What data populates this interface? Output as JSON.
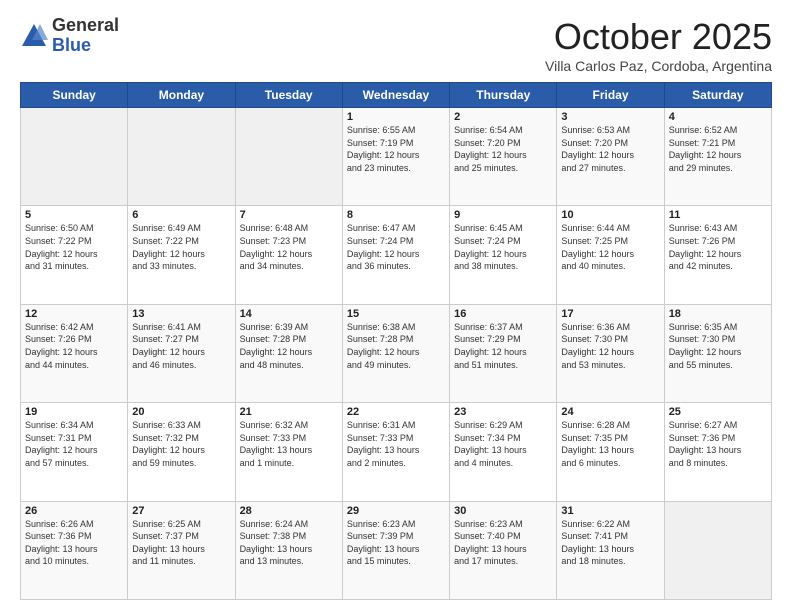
{
  "logo": {
    "general": "General",
    "blue": "Blue"
  },
  "title": "October 2025",
  "location": "Villa Carlos Paz, Cordoba, Argentina",
  "days_of_week": [
    "Sunday",
    "Monday",
    "Tuesday",
    "Wednesday",
    "Thursday",
    "Friday",
    "Saturday"
  ],
  "weeks": [
    [
      {
        "day": "",
        "info": ""
      },
      {
        "day": "",
        "info": ""
      },
      {
        "day": "",
        "info": ""
      },
      {
        "day": "1",
        "info": "Sunrise: 6:55 AM\nSunset: 7:19 PM\nDaylight: 12 hours\nand 23 minutes."
      },
      {
        "day": "2",
        "info": "Sunrise: 6:54 AM\nSunset: 7:20 PM\nDaylight: 12 hours\nand 25 minutes."
      },
      {
        "day": "3",
        "info": "Sunrise: 6:53 AM\nSunset: 7:20 PM\nDaylight: 12 hours\nand 27 minutes."
      },
      {
        "day": "4",
        "info": "Sunrise: 6:52 AM\nSunset: 7:21 PM\nDaylight: 12 hours\nand 29 minutes."
      }
    ],
    [
      {
        "day": "5",
        "info": "Sunrise: 6:50 AM\nSunset: 7:22 PM\nDaylight: 12 hours\nand 31 minutes."
      },
      {
        "day": "6",
        "info": "Sunrise: 6:49 AM\nSunset: 7:22 PM\nDaylight: 12 hours\nand 33 minutes."
      },
      {
        "day": "7",
        "info": "Sunrise: 6:48 AM\nSunset: 7:23 PM\nDaylight: 12 hours\nand 34 minutes."
      },
      {
        "day": "8",
        "info": "Sunrise: 6:47 AM\nSunset: 7:24 PM\nDaylight: 12 hours\nand 36 minutes."
      },
      {
        "day": "9",
        "info": "Sunrise: 6:45 AM\nSunset: 7:24 PM\nDaylight: 12 hours\nand 38 minutes."
      },
      {
        "day": "10",
        "info": "Sunrise: 6:44 AM\nSunset: 7:25 PM\nDaylight: 12 hours\nand 40 minutes."
      },
      {
        "day": "11",
        "info": "Sunrise: 6:43 AM\nSunset: 7:26 PM\nDaylight: 12 hours\nand 42 minutes."
      }
    ],
    [
      {
        "day": "12",
        "info": "Sunrise: 6:42 AM\nSunset: 7:26 PM\nDaylight: 12 hours\nand 44 minutes."
      },
      {
        "day": "13",
        "info": "Sunrise: 6:41 AM\nSunset: 7:27 PM\nDaylight: 12 hours\nand 46 minutes."
      },
      {
        "day": "14",
        "info": "Sunrise: 6:39 AM\nSunset: 7:28 PM\nDaylight: 12 hours\nand 48 minutes."
      },
      {
        "day": "15",
        "info": "Sunrise: 6:38 AM\nSunset: 7:28 PM\nDaylight: 12 hours\nand 49 minutes."
      },
      {
        "day": "16",
        "info": "Sunrise: 6:37 AM\nSunset: 7:29 PM\nDaylight: 12 hours\nand 51 minutes."
      },
      {
        "day": "17",
        "info": "Sunrise: 6:36 AM\nSunset: 7:30 PM\nDaylight: 12 hours\nand 53 minutes."
      },
      {
        "day": "18",
        "info": "Sunrise: 6:35 AM\nSunset: 7:30 PM\nDaylight: 12 hours\nand 55 minutes."
      }
    ],
    [
      {
        "day": "19",
        "info": "Sunrise: 6:34 AM\nSunset: 7:31 PM\nDaylight: 12 hours\nand 57 minutes."
      },
      {
        "day": "20",
        "info": "Sunrise: 6:33 AM\nSunset: 7:32 PM\nDaylight: 12 hours\nand 59 minutes."
      },
      {
        "day": "21",
        "info": "Sunrise: 6:32 AM\nSunset: 7:33 PM\nDaylight: 13 hours\nand 1 minute."
      },
      {
        "day": "22",
        "info": "Sunrise: 6:31 AM\nSunset: 7:33 PM\nDaylight: 13 hours\nand 2 minutes."
      },
      {
        "day": "23",
        "info": "Sunrise: 6:29 AM\nSunset: 7:34 PM\nDaylight: 13 hours\nand 4 minutes."
      },
      {
        "day": "24",
        "info": "Sunrise: 6:28 AM\nSunset: 7:35 PM\nDaylight: 13 hours\nand 6 minutes."
      },
      {
        "day": "25",
        "info": "Sunrise: 6:27 AM\nSunset: 7:36 PM\nDaylight: 13 hours\nand 8 minutes."
      }
    ],
    [
      {
        "day": "26",
        "info": "Sunrise: 6:26 AM\nSunset: 7:36 PM\nDaylight: 13 hours\nand 10 minutes."
      },
      {
        "day": "27",
        "info": "Sunrise: 6:25 AM\nSunset: 7:37 PM\nDaylight: 13 hours\nand 11 minutes."
      },
      {
        "day": "28",
        "info": "Sunrise: 6:24 AM\nSunset: 7:38 PM\nDaylight: 13 hours\nand 13 minutes."
      },
      {
        "day": "29",
        "info": "Sunrise: 6:23 AM\nSunset: 7:39 PM\nDaylight: 13 hours\nand 15 minutes."
      },
      {
        "day": "30",
        "info": "Sunrise: 6:23 AM\nSunset: 7:40 PM\nDaylight: 13 hours\nand 17 minutes."
      },
      {
        "day": "31",
        "info": "Sunrise: 6:22 AM\nSunset: 7:41 PM\nDaylight: 13 hours\nand 18 minutes."
      },
      {
        "day": "",
        "info": ""
      }
    ]
  ]
}
